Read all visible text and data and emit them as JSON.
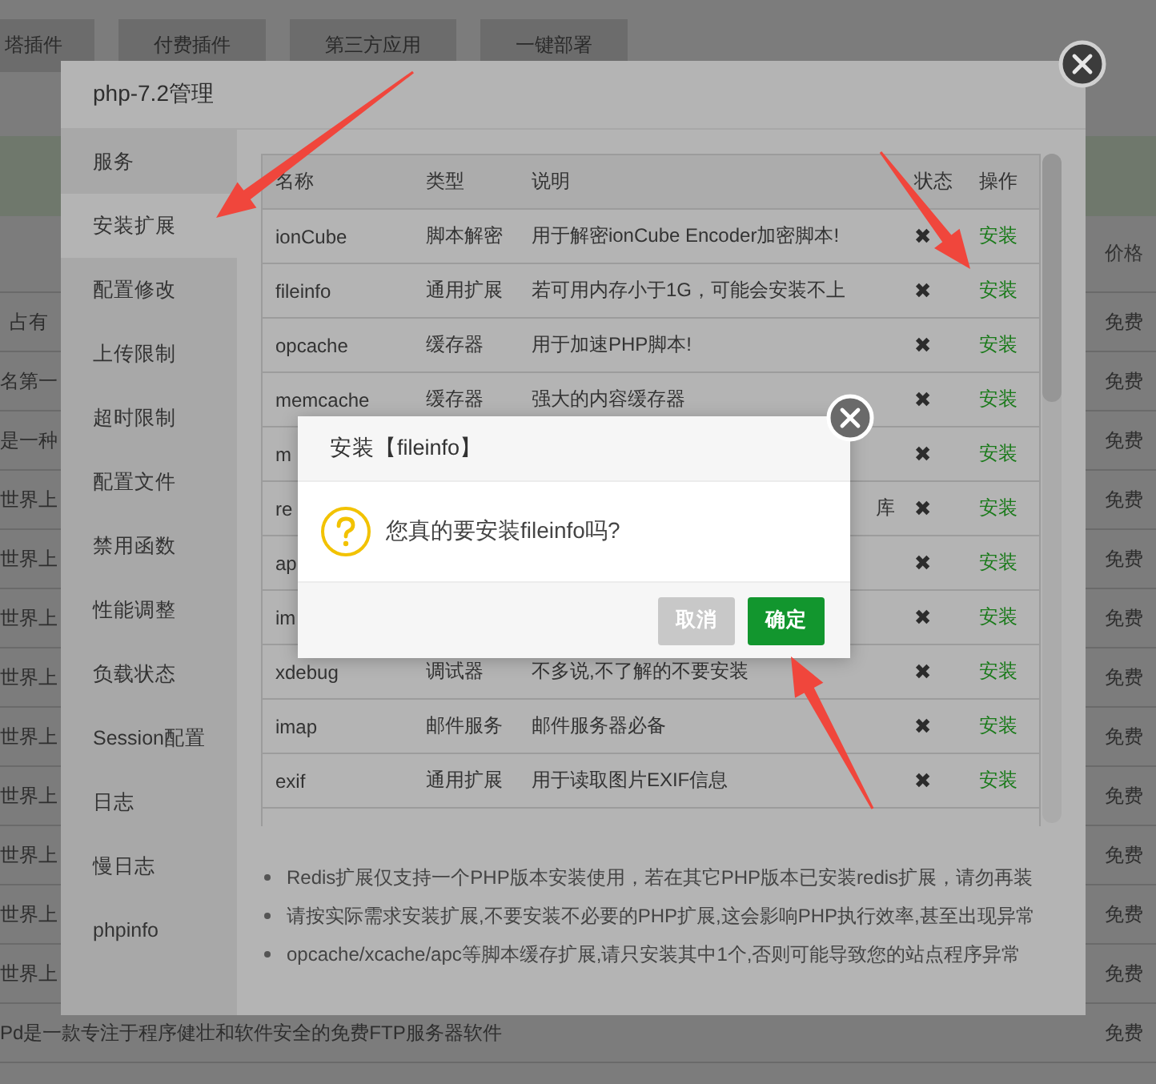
{
  "background": {
    "tabs": [
      "塔插件",
      "付费插件",
      "第三方应用",
      "一键部署"
    ],
    "price_header": "价格",
    "rows": [
      {
        "text": "占有",
        "price": "免费"
      },
      {
        "text": "名第一",
        "price": "免费"
      },
      {
        "text": "是一种",
        "price": "免费"
      },
      {
        "text": "世界上",
        "price": "免费"
      },
      {
        "text": "世界上",
        "price": "免费"
      },
      {
        "text": "世界上",
        "price": "免费"
      },
      {
        "text": "世界上",
        "price": "免费"
      },
      {
        "text": "世界上",
        "price": "免费"
      },
      {
        "text": "世界上",
        "price": "免费"
      },
      {
        "text": "世界上",
        "price": "免费"
      },
      {
        "text": "世界上",
        "price": "免费"
      },
      {
        "text": "世界上",
        "price": "免费"
      },
      {
        "text": "Pd是一款专注于程序健壮和软件安全的免费FTP服务器软件",
        "price": "免费"
      }
    ]
  },
  "modal": {
    "title": "php-7.2管理",
    "sidebar": [
      {
        "label": "服务",
        "selected": false
      },
      {
        "label": "安装扩展",
        "selected": true
      },
      {
        "label": "配置修改",
        "selected": false
      },
      {
        "label": "上传限制",
        "selected": false
      },
      {
        "label": "超时限制",
        "selected": false
      },
      {
        "label": "配置文件",
        "selected": false
      },
      {
        "label": "禁用函数",
        "selected": false
      },
      {
        "label": "性能调整",
        "selected": false
      },
      {
        "label": "负载状态",
        "selected": false
      },
      {
        "label": "Session配置",
        "selected": false
      },
      {
        "label": "日志",
        "selected": false
      },
      {
        "label": "慢日志",
        "selected": false
      },
      {
        "label": "phpinfo",
        "selected": false
      }
    ],
    "table": {
      "columns": [
        "名称",
        "类型",
        "说明",
        "状态",
        "操作"
      ],
      "rows": [
        {
          "name": "ionCube",
          "type": "脚本解密",
          "description": "用于解密ionCube Encoder加密脚本!",
          "status": "✖",
          "action": "安装"
        },
        {
          "name": "fileinfo",
          "type": "通用扩展",
          "description": "若可用内存小于1G，可能会安装不上",
          "status": "✖",
          "action": "安装"
        },
        {
          "name": "opcache",
          "type": "缓存器",
          "description": "用于加速PHP脚本!",
          "status": "✖",
          "action": "安装"
        },
        {
          "name": "memcache",
          "type": "缓存器",
          "description": "强大的内容缓存器",
          "status": "✖",
          "action": "安装"
        },
        {
          "name": "m",
          "status": "✖",
          "action": "安装"
        },
        {
          "name": "re",
          "description": "库",
          "status": "✖",
          "action": "安装"
        },
        {
          "name": "ap",
          "status": "✖",
          "action": "安装"
        },
        {
          "name": "im",
          "status": "✖",
          "action": "安装"
        },
        {
          "name": "xdebug",
          "type": "调试器",
          "description": "不多说,不了解的不要安装",
          "status": "✖",
          "action": "安装"
        },
        {
          "name": "imap",
          "type": "邮件服务",
          "description": "邮件服务器必备",
          "status": "✖",
          "action": "安装"
        },
        {
          "name": "exif",
          "type": "通用扩展",
          "description": "用于读取图片EXIF信息",
          "status": "✖",
          "action": "安装"
        }
      ]
    },
    "notes": [
      "Redis扩展仅支持一个PHP版本安装使用，若在其它PHP版本已安装redis扩展，请勿再装",
      "请按实际需求安装扩展,不要安装不必要的PHP扩展,这会影响PHP执行效率,甚至出现异常",
      "opcache/xcache/apc等脚本缓存扩展,请只安装其中1个,否则可能导致您的站点程序异常"
    ]
  },
  "dialog": {
    "title": "安装【fileinfo】",
    "message": "您真的要安装fileinfo吗?",
    "buttons": [
      {
        "label": "取消",
        "kind": "cancel"
      },
      {
        "label": "确定",
        "kind": "confirm"
      }
    ]
  }
}
